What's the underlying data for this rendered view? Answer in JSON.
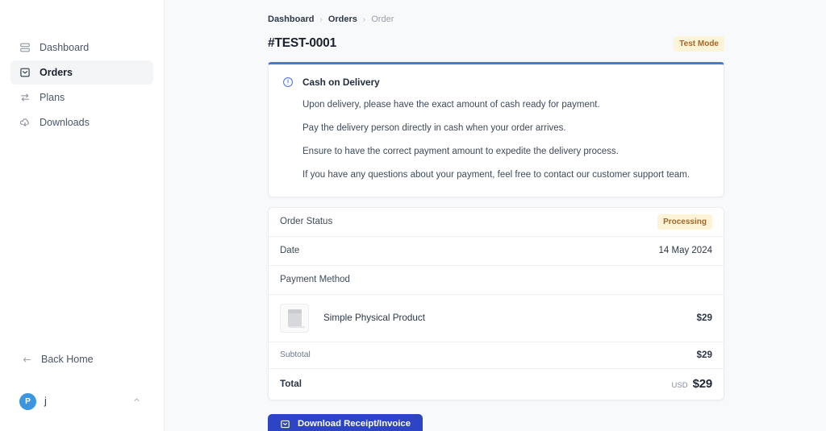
{
  "sidebar": {
    "items": [
      {
        "label": "Dashboard",
        "icon": "layers-icon",
        "active": false
      },
      {
        "label": "Orders",
        "icon": "inbox-icon",
        "active": true
      },
      {
        "label": "Plans",
        "icon": "exchange-arrows-icon",
        "active": false
      },
      {
        "label": "Downloads",
        "icon": "cloud-download-icon",
        "active": false
      }
    ],
    "back_home_label": "Back Home",
    "user": {
      "avatar_initial": "P",
      "name": "j",
      "avatar_color": "#3b95e0"
    }
  },
  "header": {
    "breadcrumb": {
      "items": [
        "Dashboard",
        "Orders",
        "Order"
      ],
      "separator": "›"
    },
    "title": "#TEST-0001",
    "mode_badge": {
      "label": "Test Mode",
      "bg": "#fdf3d7",
      "color": "#a1672a"
    }
  },
  "alert": {
    "accent_color": "#4f73e3",
    "title": "Cash on Delivery",
    "lines": [
      "Upon delivery, please have the exact amount of cash ready for payment.",
      "Pay the delivery person directly in cash when your order arrives.",
      "Ensure to have the correct payment amount to expedite the delivery process.",
      "If you have any questions about your payment, feel free to contact our customer support team."
    ]
  },
  "order": {
    "status_row": {
      "label": "Order Status",
      "badge": {
        "label": "Processing",
        "bg": "#fdf3d7",
        "color": "#a1672a"
      }
    },
    "date_row": {
      "label": "Date",
      "value": "14 May 2024"
    },
    "payment_row": {
      "label": "Payment Method",
      "value": ""
    },
    "line_items": [
      {
        "name": "Simple Physical Product",
        "price": "$29"
      }
    ],
    "subtotal": {
      "label": "Subtotal",
      "value": "$29"
    },
    "total": {
      "label": "Total",
      "currency": "USD",
      "value": "$29"
    }
  },
  "actions": {
    "download_label": "Download Receipt/Invoice",
    "download_color": "#2d45c4"
  }
}
